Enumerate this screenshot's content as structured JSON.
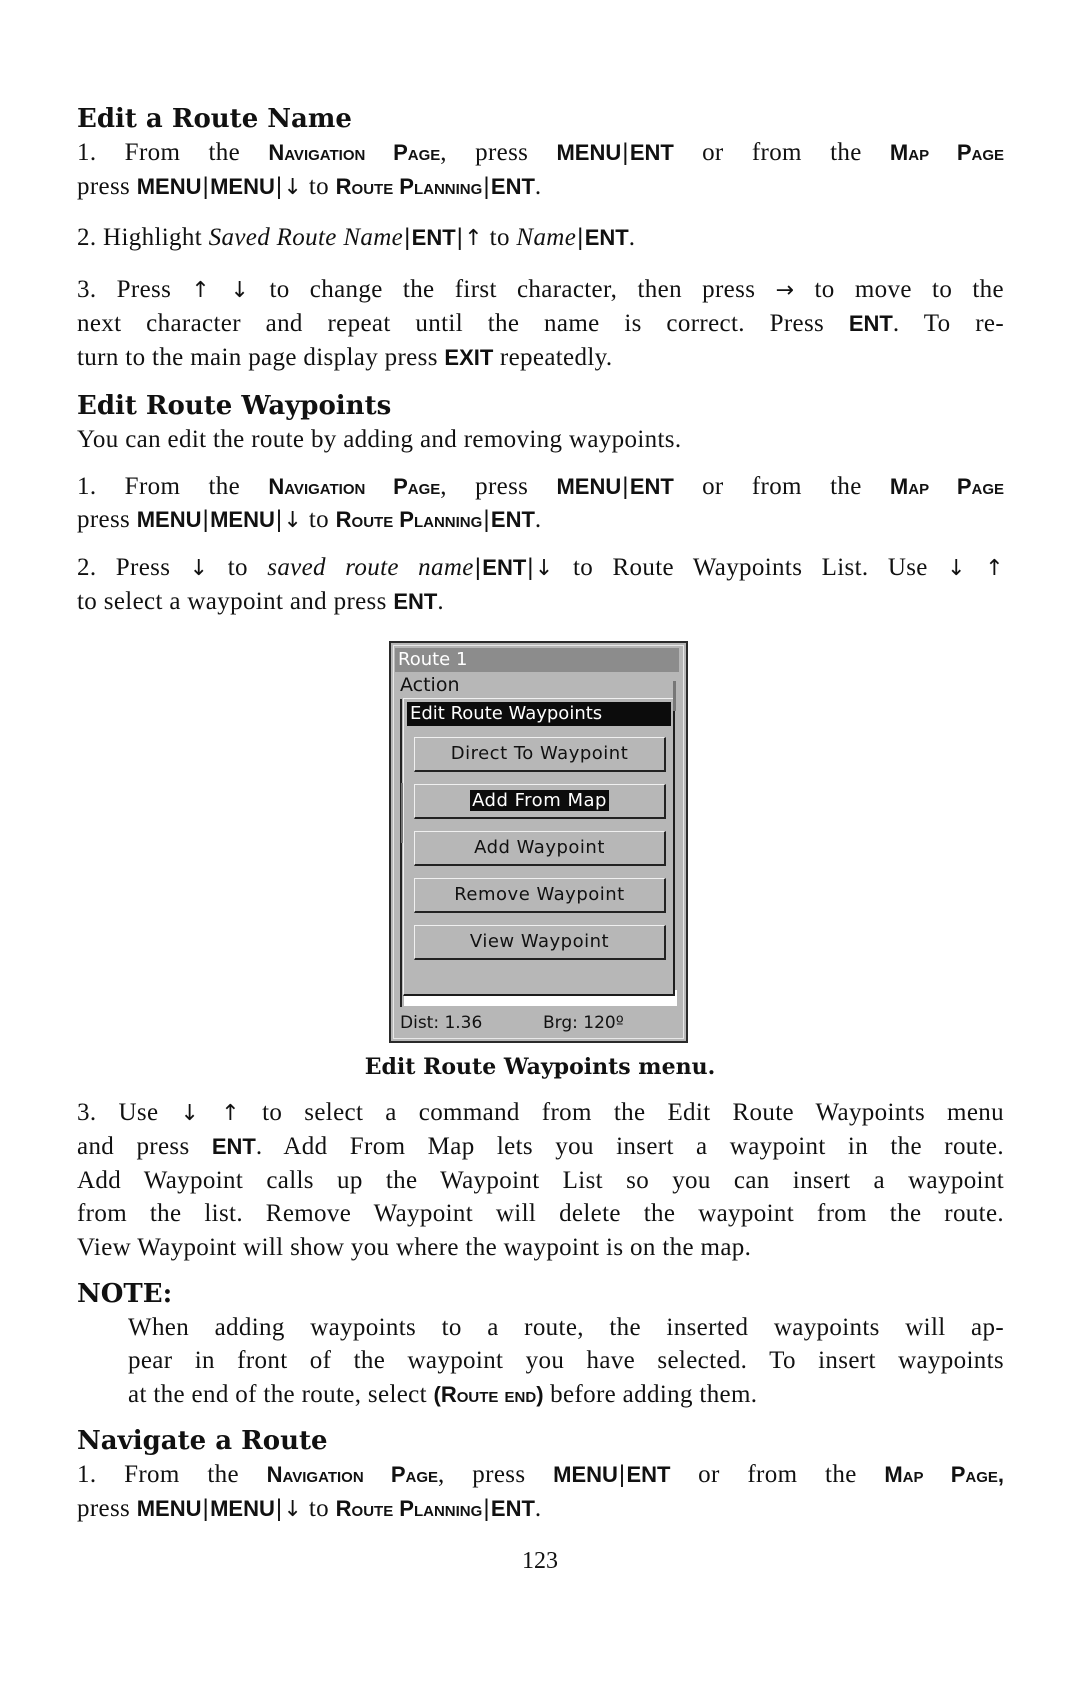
{
  "sections": {
    "edit_name": {
      "heading": "Edit a Route Name",
      "s1_l1": {
        "a": "1. From the ",
        "b": "Navigation Page",
        "c": ", press ",
        "d": "MENU",
        "e": "ENT",
        "f": " or from the ",
        "g": "Map Page"
      },
      "s1_l2": {
        "a": "press ",
        "b": "MENU",
        "c": "MENU",
        "arrow": "↓",
        "d": " to ",
        "e": "Route Planning",
        "f": "ENT",
        "g": "."
      },
      "s2": {
        "a": "2. Highlight ",
        "b": "Saved Route Name",
        "c": "ENT",
        "arrow": "↑",
        "d": " to ",
        "e": "Name",
        "f": "ENT",
        "g": "."
      },
      "s3_l1": {
        "a": "3. Press ",
        "arrow1": "↑",
        "arrow2": "↓",
        "b": " to change the first character, then press ",
        "arrow3": "→",
        "c": " to move to the"
      },
      "s3_l2": {
        "a": "next character and repeat until the name is correct. Press ",
        "b": "ENT",
        "c": ". To re-"
      },
      "s3_l3": {
        "a": "turn to the main page display press ",
        "b": "EXIT",
        "c": " repeatedly."
      }
    },
    "edit_waypoints": {
      "heading": "Edit Route Waypoints",
      "intro": "You can edit the route by adding and removing waypoints.",
      "s1_l1": {
        "a": "1. From the ",
        "b": "Navigation Page",
        "c": ", press ",
        "d": "MENU",
        "e": "ENT",
        "f": " or from the ",
        "g": "Map Page"
      },
      "s1_l2": {
        "a": "press ",
        "b": "MENU",
        "c": "MENU",
        "arrow": "↓",
        "d": " to ",
        "e": "Route Planning",
        "f": "ENT",
        "g": "."
      },
      "s2_l1": {
        "a": "2. Press ",
        "arrow": "↓",
        "b": " to ",
        "c": "saved route name",
        "d": "ENT",
        "arrow2": "↓",
        "e": " to Route Waypoints List. Use ",
        "arrow3": "↓",
        "arrow4": "↑"
      },
      "s2_l2": {
        "a": "to select a waypoint and press ",
        "b": "ENT",
        "c": "."
      },
      "caption": "Edit Route Waypoints menu.",
      "s3_l1": {
        "a": "3. Use ",
        "arrow1": "↓",
        "arrow2": "↑",
        "b": " to select a command from the Edit Route Waypoints menu"
      },
      "s3_l2": {
        "a": "and press ",
        "b": "ENT",
        "c": ". Add From Map lets you insert a waypoint in the route."
      },
      "s3_l3": "Add Waypoint calls up the Waypoint List so you can insert a waypoint",
      "s3_l4": "from the list. Remove Waypoint will delete the waypoint from the route.",
      "s3_l5": "View Waypoint will show you where the waypoint is on the map.",
      "note_label": "NOTE:",
      "note_l1": "When adding waypoints to a route, the inserted waypoints will ap-",
      "note_l2": "pear in front of the waypoint you have selected. To insert waypoints",
      "note_l3": {
        "a": "at the end of the route, select ",
        "b": "(Route end)",
        "c": " before adding them."
      }
    },
    "navigate": {
      "heading": "Navigate a Route",
      "s1_l1": {
        "a": "1. From the ",
        "b": "Navigation Page",
        "c": ", press ",
        "d": "MENU",
        "e": "ENT",
        "f": " or from the ",
        "g": "Map Page,"
      },
      "s1_l2": {
        "a": "press ",
        "b": "MENU",
        "c": "MENU",
        "arrow": "↓",
        "d": " to ",
        "e": "Route Planning",
        "f": "ENT",
        "g": "."
      }
    }
  },
  "separator": "|",
  "device_screen": {
    "title": "Route 1",
    "action_label": "Action",
    "popup_title": "Edit Route Waypoints",
    "buttons": [
      {
        "label": "Direct To Waypoint",
        "selected": false
      },
      {
        "label": "Add From Map",
        "selected": true
      },
      {
        "label": "Add Waypoint",
        "selected": false
      },
      {
        "label": "Remove Waypoint",
        "selected": false
      },
      {
        "label": "View Waypoint",
        "selected": false
      }
    ],
    "dist": "Dist: 1.36",
    "brg": "Brg: 120º"
  },
  "page_number": "123"
}
